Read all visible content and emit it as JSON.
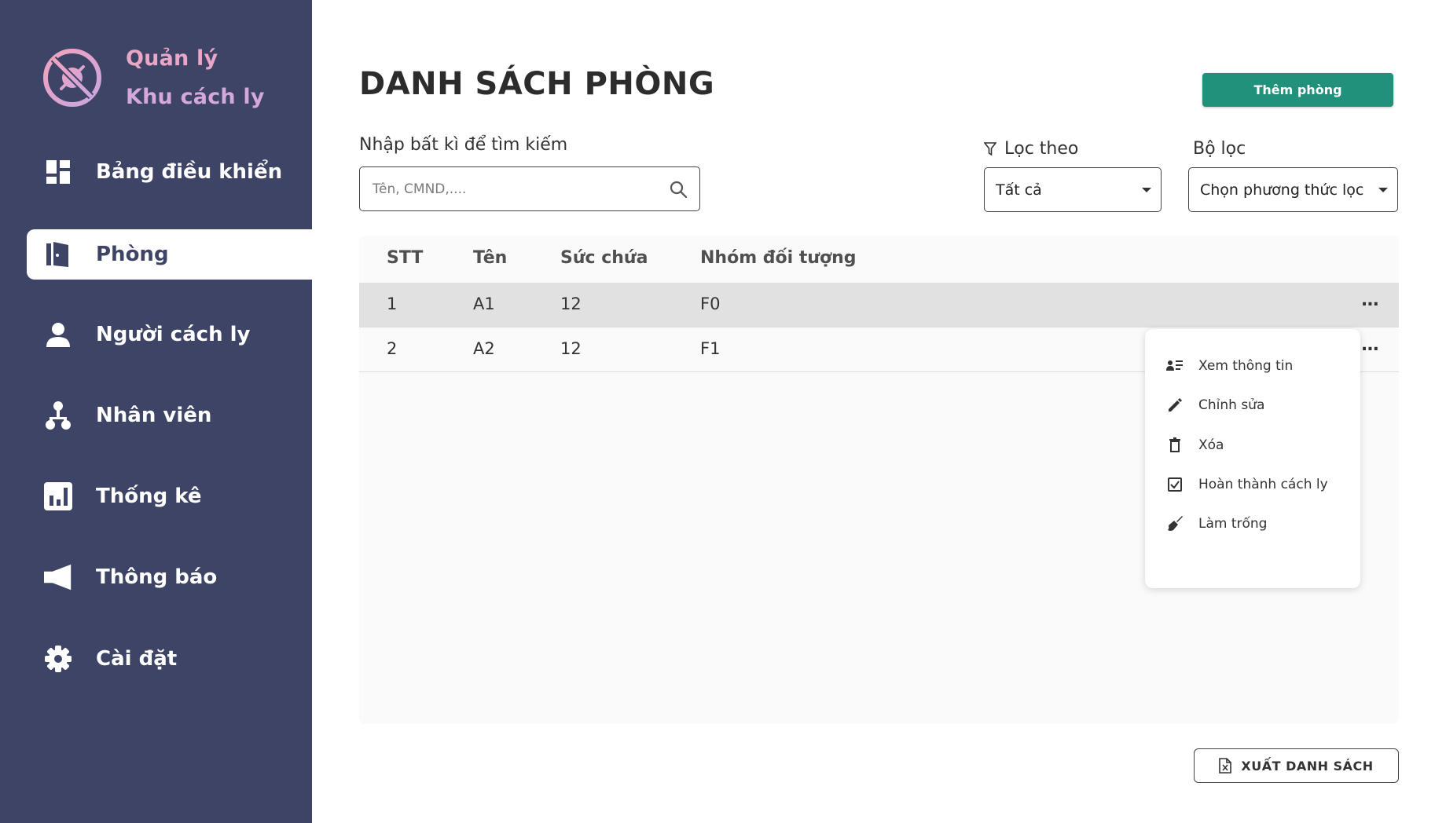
{
  "app": {
    "brand_line1": "Quản lý",
    "brand_line2": "Khu cách ly",
    "brand_color": "#e9a6c6",
    "sidebar_bg": "#3e4466",
    "accent": "#21917c"
  },
  "sidebar": {
    "items": [
      {
        "label": "Bảng điều khiển",
        "icon": "dashboard-icon"
      },
      {
        "label": "Phòng",
        "icon": "door-icon",
        "active": true
      },
      {
        "label": "Người cách ly",
        "icon": "person-icon"
      },
      {
        "label": "Nhân viên",
        "icon": "staff-hierarchy-icon"
      },
      {
        "label": "Thống kê",
        "icon": "bar-chart-icon"
      },
      {
        "label": "Thông báo",
        "icon": "megaphone-icon"
      },
      {
        "label": "Cài đặt",
        "icon": "gear-icon"
      }
    ]
  },
  "main": {
    "title": "DANH SÁCH PHÒNG",
    "add_button": "Thêm phòng",
    "search": {
      "label": "Nhập bất kì để tìm kiếm",
      "placeholder": "Tên, CMND,...."
    },
    "filter": {
      "label": "Lọc theo",
      "value": "Tất cả"
    },
    "method": {
      "label": "Bộ lọc",
      "value": "Chọn phương thức lọc"
    },
    "table": {
      "columns": [
        "STT",
        "Tên",
        "Sức chứa",
        "Nhóm đối tượng"
      ],
      "rows": [
        [
          "1",
          "A1",
          "12",
          "F0"
        ],
        [
          "2",
          "A2",
          "12",
          "F1"
        ]
      ],
      "more_label": "..."
    },
    "context_menu": [
      {
        "label": "Xem thông tin",
        "icon": "view-info-icon"
      },
      {
        "label": "Chỉnh sửa",
        "icon": "pencil-icon"
      },
      {
        "label": "Xóa",
        "icon": "trash-icon"
      },
      {
        "label": "Hoàn thành cách ly",
        "icon": "checkbox-icon"
      },
      {
        "label": "Làm trống",
        "icon": "broom-icon"
      }
    ],
    "export_button": "XUẤT DANH SÁCH"
  }
}
